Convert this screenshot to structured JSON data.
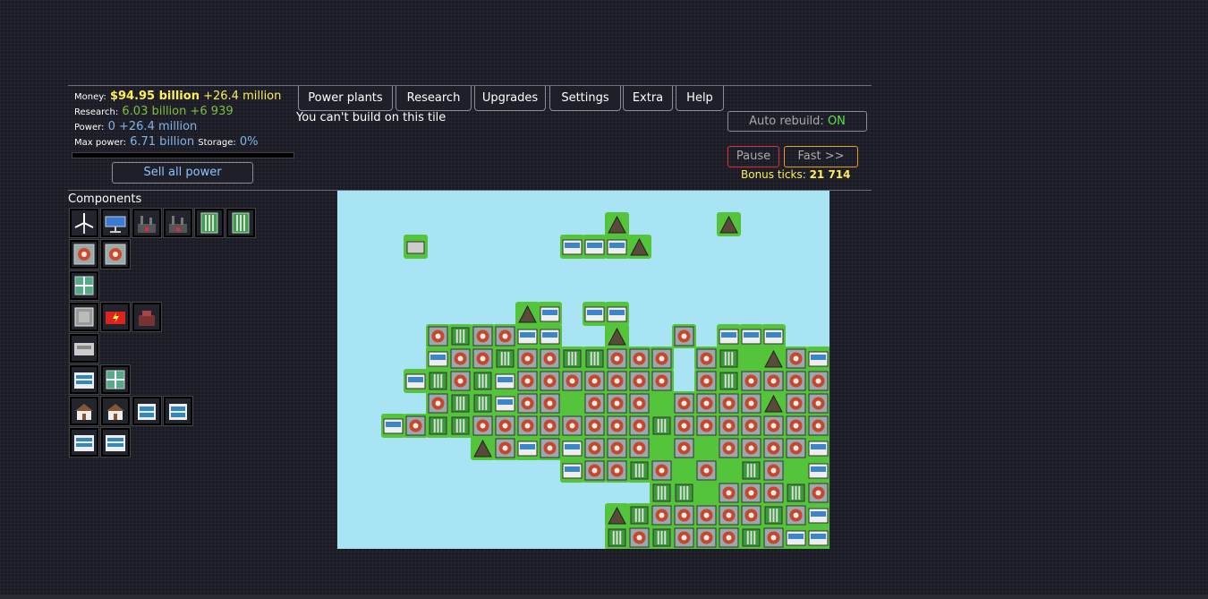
{
  "stats": {
    "money_label": "Money:",
    "money_value": "$94.95 billion",
    "money_delta": "+26.4 million",
    "research_label": "Research:",
    "research_value": "6.03 billion",
    "research_delta": "+6 939",
    "power_label": "Power:",
    "power_value": "0",
    "power_delta": "+26.4 million",
    "maxpower_label": "Max power:",
    "maxpower_value": "6.71 billion",
    "storage_label": "Storage:",
    "storage_value": "0%"
  },
  "sell_label": "Sell all power",
  "tabs": [
    "Power plants",
    "Research",
    "Upgrades",
    "Settings",
    "Extra",
    "Help"
  ],
  "message": "You can't build on this tile",
  "auto_rebuild": {
    "label": "Auto rebuild:",
    "state": "ON"
  },
  "pause_label": "Pause",
  "fast_label": "Fast >>",
  "bonus": {
    "label": "Bonus ticks:",
    "value": "21 714"
  },
  "components_title": "Components",
  "components": [
    [
      "wind-turbine",
      "solar-panel",
      "coal-plant",
      "gas-plant",
      "water-pump",
      "water-pump-large"
    ],
    [
      "heat-exchanger",
      "heat-exchanger-large"
    ],
    [
      "heat-inlet"
    ],
    [
      "battery",
      "research-lab",
      "generator"
    ],
    [
      "office"
    ],
    [
      "heat-outlet",
      "heat-vent"
    ],
    [
      "house-small",
      "house",
      "shop",
      "shop-large"
    ],
    [
      "factory",
      "factory-large"
    ]
  ],
  "colors": {
    "water": "#a8e4f4",
    "grass": "#54c43a",
    "money": "#ffee55",
    "research": "#7fbf3f",
    "on": "#59e04a"
  },
  "map": {
    "cols": 22,
    "rows": 16,
    "tiles": [
      "......................",
      "............M....M....",
      "...O......SSSM........",
      "......................",
      "......................",
      "........MS.SS.........",
      "....TCTTSS..M..T.SSS..",
      "....STTCTTCCTTT.TCGMTS",
      "...SCTCSTTTTTTT.TCTTTT",
      "....TCCSTTGTTTGTTTTMTT",
      "..STCCTTTTTTTTCTTTTTTT",
      "......MTSTSTTTGTGTTTTS",
      "..........STTCTGTGCTGS",
      "..............CCGTTTCT",
      "............MCTTTTTCTS",
      "............CTCTTTCTSS"
    ]
  }
}
